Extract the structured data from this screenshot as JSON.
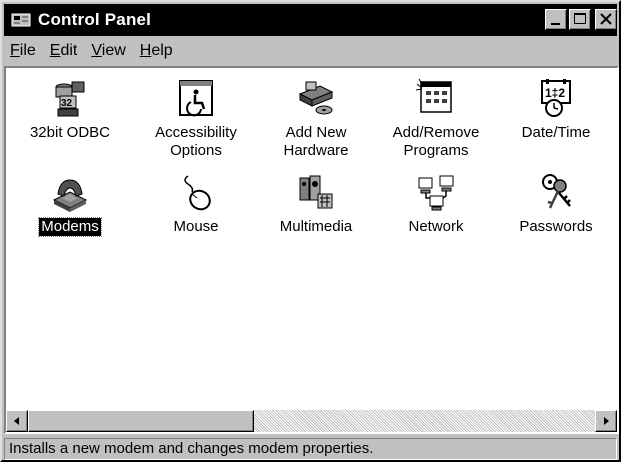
{
  "window": {
    "title": "Control Panel",
    "icon": "control-panel-icon"
  },
  "title_buttons": [
    {
      "name": "minimize-button",
      "icon": "minimize-icon"
    },
    {
      "name": "maximize-button",
      "icon": "maximize-icon"
    },
    {
      "name": "close-button",
      "icon": "close-icon"
    }
  ],
  "menu": {
    "items": [
      {
        "accel": "F",
        "rest": "ile"
      },
      {
        "accel": "E",
        "rest": "dit"
      },
      {
        "accel": "V",
        "rest": "iew"
      },
      {
        "accel": "H",
        "rest": "elp"
      }
    ]
  },
  "icons": [
    {
      "line1": "32bit ODBC",
      "line2": "",
      "icon": "odbc-database-icon",
      "selected": false
    },
    {
      "line1": "Accessibility",
      "line2": "Options",
      "icon": "accessibility-icon",
      "selected": false
    },
    {
      "line1": "Add New",
      "line2": "Hardware",
      "icon": "hardware-icon",
      "selected": false
    },
    {
      "line1": "Add/Remove",
      "line2": "Programs",
      "icon": "programs-icon",
      "selected": false
    },
    {
      "line1": "Date/Time",
      "line2": "",
      "icon": "calendar-clock-icon",
      "selected": false
    },
    {
      "line1": "Modems",
      "line2": "",
      "icon": "modem-phone-icon",
      "selected": true
    },
    {
      "line1": "Mouse",
      "line2": "",
      "icon": "mouse-icon",
      "selected": false
    },
    {
      "line1": "Multimedia",
      "line2": "",
      "icon": "multimedia-icon",
      "selected": false
    },
    {
      "line1": "Network",
      "line2": "",
      "icon": "network-icon",
      "selected": false
    },
    {
      "line1": "Passwords",
      "line2": "",
      "icon": "keys-icon",
      "selected": false
    }
  ],
  "scrollbar": {
    "left_icon": "arrow-left-icon",
    "right_icon": "arrow-right-icon"
  },
  "status": {
    "text": "Installs a new modem and changes modem properties."
  }
}
